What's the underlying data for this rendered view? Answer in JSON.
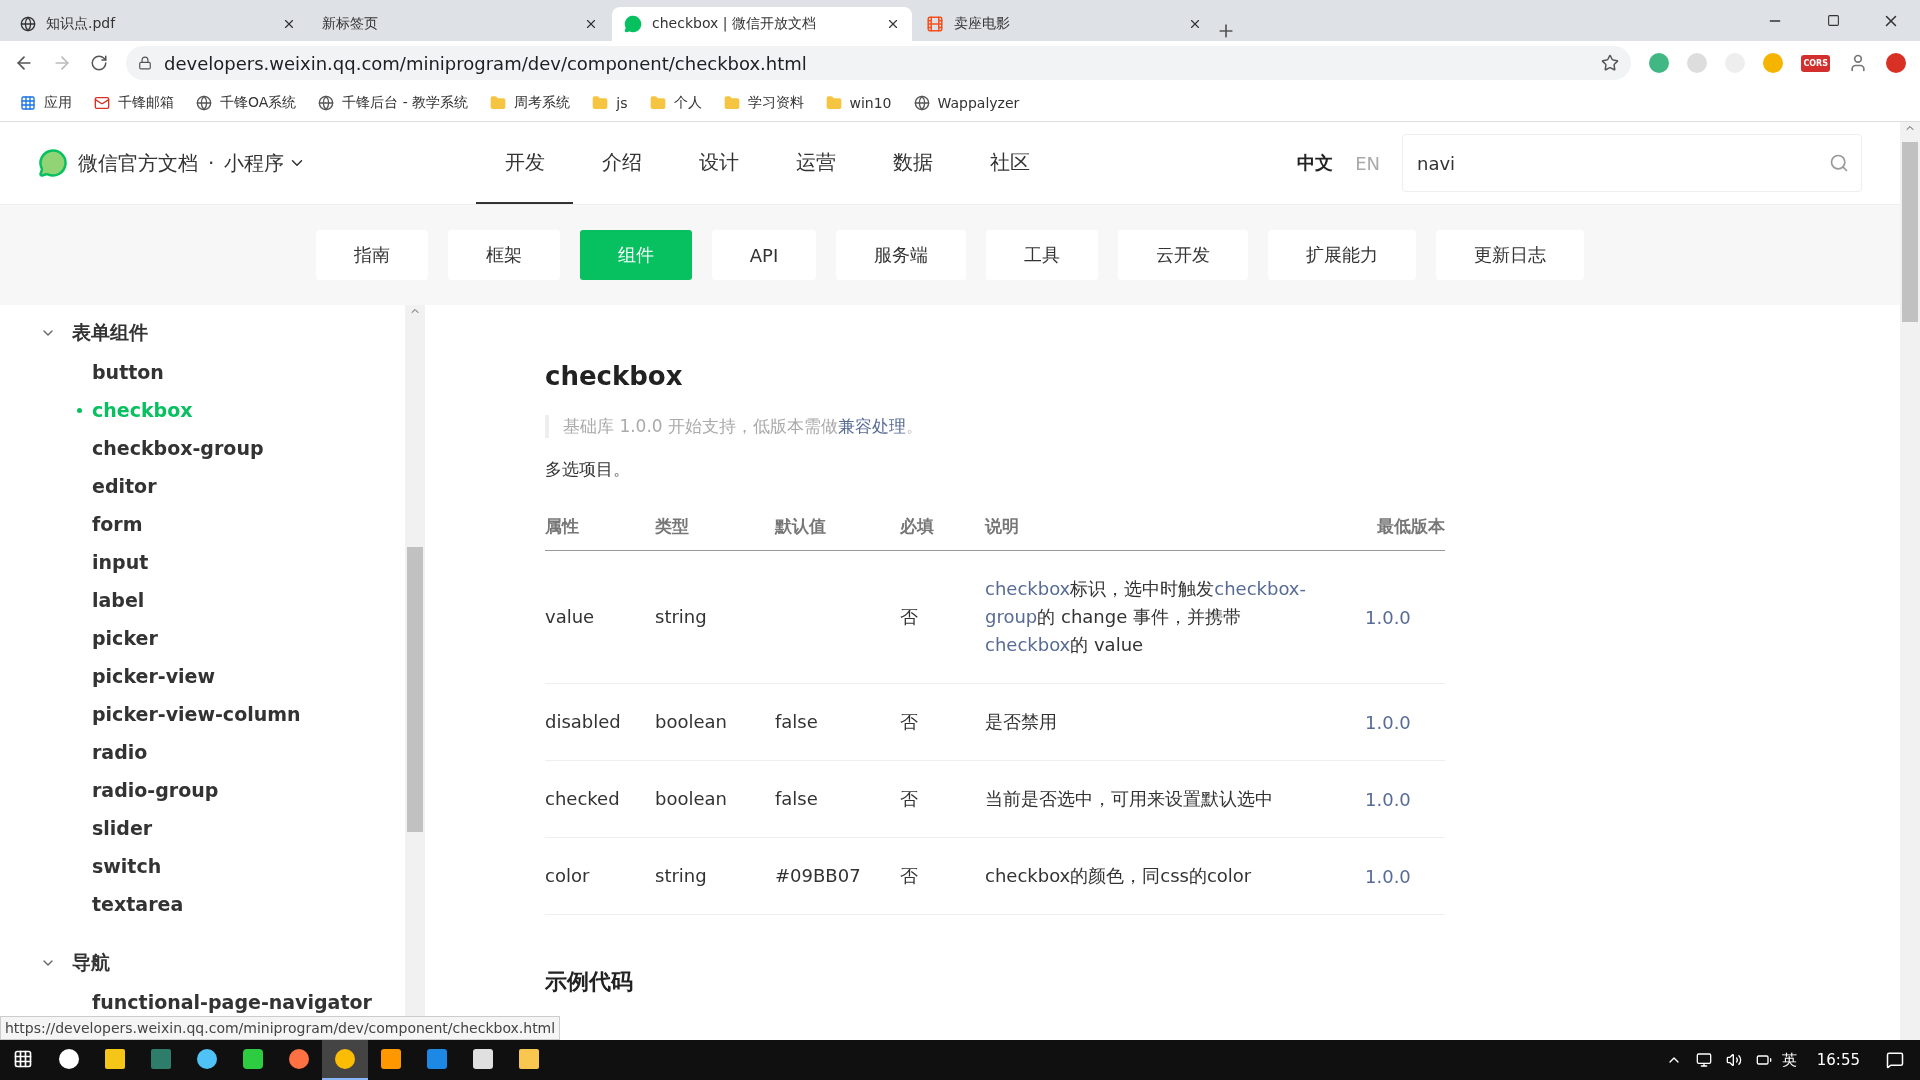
{
  "browser": {
    "tabs": [
      {
        "title": "知识点.pdf",
        "kind": "globe",
        "selected": false
      },
      {
        "title": "新标签页",
        "kind": "blank",
        "selected": false
      },
      {
        "title": "checkbox | 微信开放文档",
        "kind": "chat",
        "selected": true
      },
      {
        "title": "卖座电影",
        "kind": "film",
        "selected": false
      }
    ],
    "url": "developers.weixin.qq.com/miniprogram/dev/component/checkbox.html",
    "extension_badge": "CORS",
    "bookmarks": [
      {
        "label": "应用",
        "kind": "apps"
      },
      {
        "label": "千锋邮箱",
        "kind": "mail"
      },
      {
        "label": "千锋OA系统",
        "kind": "globe"
      },
      {
        "label": "千锋后台 - 教学系统",
        "kind": "globe"
      },
      {
        "label": "周考系统",
        "kind": "folder"
      },
      {
        "label": "js",
        "kind": "folder"
      },
      {
        "label": "个人",
        "kind": "folder"
      },
      {
        "label": "学习资料",
        "kind": "folder"
      },
      {
        "label": "win10",
        "kind": "folder"
      },
      {
        "label": "Wappalyzer",
        "kind": "globe"
      }
    ],
    "status_url": "https://developers.weixin.qq.com/miniprogram/dev/component/checkbox.html"
  },
  "site": {
    "brand": "微信官方文档",
    "separator": "·",
    "product": "小程序",
    "nav": [
      {
        "label": "开发",
        "selected": true
      },
      {
        "label": "介绍",
        "selected": false
      },
      {
        "label": "设计",
        "selected": false
      },
      {
        "label": "运营",
        "selected": false
      },
      {
        "label": "数据",
        "selected": false
      },
      {
        "label": "社区",
        "selected": false
      }
    ],
    "languages": [
      {
        "label": "中文",
        "selected": true
      },
      {
        "label": "EN",
        "selected": false
      }
    ],
    "search": {
      "value": "navi"
    },
    "subnav": [
      {
        "label": "指南",
        "selected": false
      },
      {
        "label": "框架",
        "selected": false
      },
      {
        "label": "组件",
        "selected": true
      },
      {
        "label": "API",
        "selected": false
      },
      {
        "label": "服务端",
        "selected": false
      },
      {
        "label": "工具",
        "selected": false
      },
      {
        "label": "云开发",
        "selected": false
      },
      {
        "label": "扩展能力",
        "selected": false
      },
      {
        "label": "更新日志",
        "selected": false
      }
    ]
  },
  "sidebar": {
    "groups": [
      {
        "title": "表单组件",
        "expanded": true,
        "items": [
          {
            "label": "button",
            "selected": false
          },
          {
            "label": "checkbox",
            "selected": true
          },
          {
            "label": "checkbox-group",
            "selected": false
          },
          {
            "label": "editor",
            "selected": false
          },
          {
            "label": "form",
            "selected": false
          },
          {
            "label": "input",
            "selected": false
          },
          {
            "label": "label",
            "selected": false
          },
          {
            "label": "picker",
            "selected": false
          },
          {
            "label": "picker-view",
            "selected": false
          },
          {
            "label": "picker-view-column",
            "selected": false
          },
          {
            "label": "radio",
            "selected": false
          },
          {
            "label": "radio-group",
            "selected": false
          },
          {
            "label": "slider",
            "selected": false
          },
          {
            "label": "switch",
            "selected": false
          },
          {
            "label": "textarea",
            "selected": false
          }
        ]
      },
      {
        "title": "导航",
        "expanded": true,
        "items": [
          {
            "label": "functional-page-navigator",
            "selected": false
          }
        ]
      }
    ]
  },
  "content": {
    "title": "checkbox",
    "note": {
      "text": "基础库 1.0.0 开始支持，低版本需做",
      "link": "兼容处理",
      "end": "。"
    },
    "intro": "多选项目。",
    "columns": [
      "属性",
      "类型",
      "默认值",
      "必填",
      "说明",
      "最低版本"
    ],
    "rows": [
      {
        "name": "value",
        "type": "string",
        "default": "",
        "required": "否",
        "description": [
          {
            "text": "checkbox",
            "link": true
          },
          {
            "text": "标识，选中时触发",
            "link": false
          },
          {
            "text": "checkbox-group",
            "link": true
          },
          {
            "text": "的 change 事件，并携带 ",
            "link": false
          },
          {
            "text": "checkbox",
            "link": true
          },
          {
            "text": "的 value",
            "link": false
          }
        ],
        "version": "1.0.0"
      },
      {
        "name": "disabled",
        "type": "boolean",
        "default": "false",
        "required": "否",
        "description": [
          {
            "text": "是否禁用",
            "link": false
          }
        ],
        "version": "1.0.0"
      },
      {
        "name": "checked",
        "type": "boolean",
        "default": "false",
        "required": "否",
        "description": [
          {
            "text": "当前是否选中，可用来设置默认选中",
            "link": false
          }
        ],
        "version": "1.0.0"
      },
      {
        "name": "color",
        "type": "string",
        "default": "#09BB07",
        "required": "否",
        "description": [
          {
            "text": "checkbox的颜色，同css的color",
            "link": false
          }
        ],
        "version": "1.0.0"
      }
    ],
    "section": "示例代码"
  },
  "taskbar": {
    "apps": [
      {
        "kind": "chat",
        "active": false
      },
      {
        "kind": "notes",
        "active": false
      },
      {
        "kind": "book",
        "active": false
      },
      {
        "kind": "ball",
        "active": false
      },
      {
        "kind": "gear",
        "active": false
      },
      {
        "kind": "fox",
        "active": false
      },
      {
        "kind": "chrome",
        "active": true
      },
      {
        "kind": "sublime",
        "active": false
      },
      {
        "kind": "vscode",
        "active": false
      },
      {
        "kind": "code",
        "active": false
      },
      {
        "kind": "folder",
        "active": false
      }
    ],
    "ime": "英",
    "time": "16:55"
  }
}
